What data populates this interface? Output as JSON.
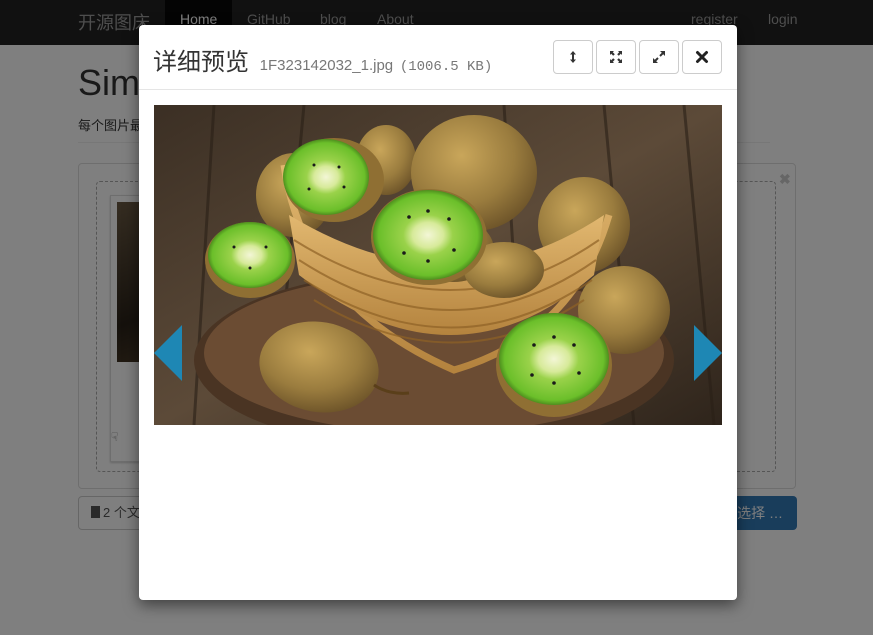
{
  "navbar": {
    "brand": "开源图床",
    "items": [
      "Home",
      "GitHub",
      "blog",
      "About"
    ],
    "right_items": [
      "register",
      "login"
    ]
  },
  "page": {
    "title": "Sim",
    "subtitle": "每个图片最"
  },
  "uploader": {
    "caption_text": "2 个文",
    "browse_label": "选择 …"
  },
  "modal": {
    "title": "详细预览",
    "filename": "1F323142032_1.jpg",
    "filesize": "(1006.5 KB)",
    "icons": [
      "toggle-height-icon",
      "fullscreen-icon",
      "enlarge-icon",
      "close-icon"
    ]
  },
  "colors": {
    "navbar_bg": "#222222",
    "primary": "#337ab7",
    "arrow": "#1e87b4",
    "kiwi_green": "#7cc63a",
    "kiwi_skin": "#9a7c3e"
  }
}
